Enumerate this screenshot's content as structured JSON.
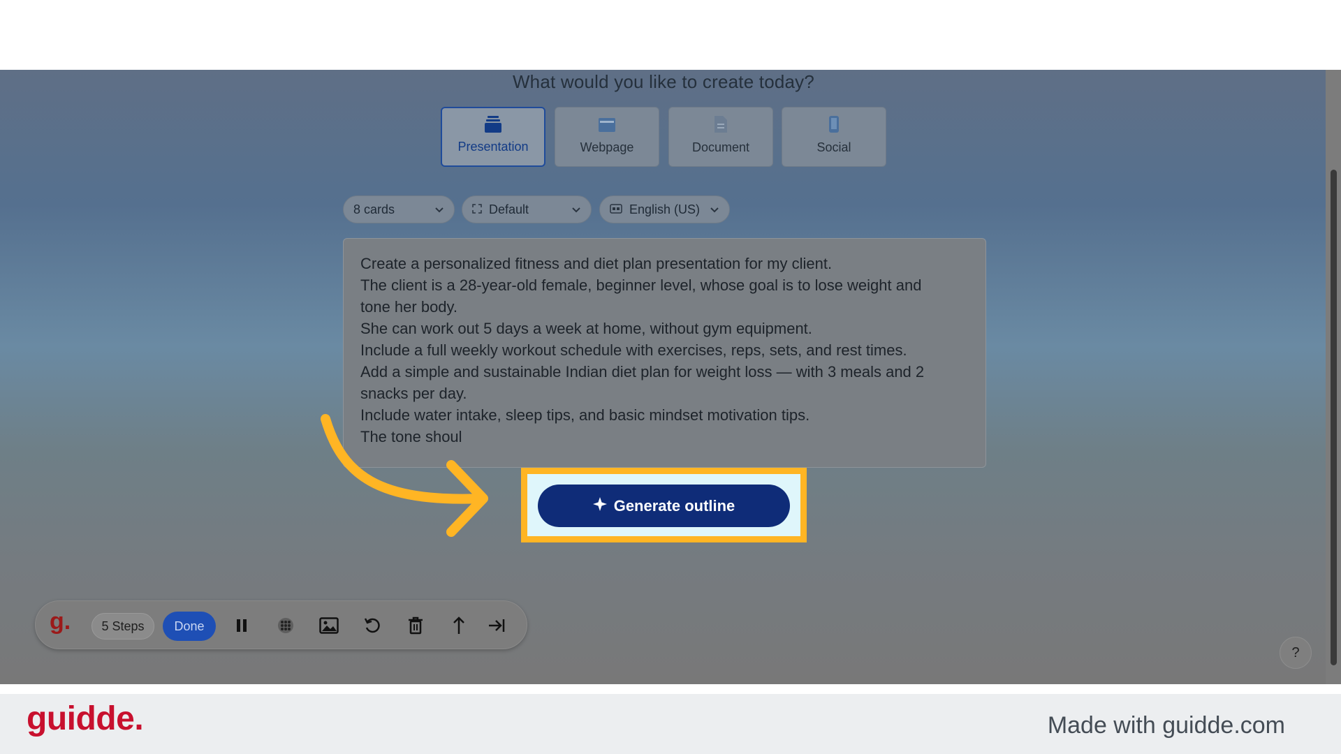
{
  "headline": "What would you like to create today?",
  "content_types": [
    {
      "label": "Presentation",
      "icon": "presentation-icon",
      "selected": true
    },
    {
      "label": "Webpage",
      "icon": "webpage-icon",
      "selected": false
    },
    {
      "label": "Document",
      "icon": "document-icon",
      "selected": false
    },
    {
      "label": "Social",
      "icon": "phone-icon",
      "selected": false
    }
  ],
  "options": {
    "cards": "8 cards",
    "format": "Default",
    "language": "English (US)"
  },
  "prompt_lines": [
    "Create a personalized fitness and diet plan presentation for my client.",
    "The client is a 28-year-old female, beginner level, whose goal is to lose weight and",
    "tone her body.",
    "She can work out 5 days a week at home, without gym equipment.",
    "Include a full weekly workout schedule with exercises, reps, sets, and rest times.",
    "Add a simple and sustainable Indian diet plan for weight loss — with 3 meals and 2",
    "snacks per day.",
    "Include water intake, sleep tips, and basic mindset motivation tips.",
    "The tone shoul"
  ],
  "generate_button": "Generate outline",
  "recorder": {
    "logo": "g.",
    "steps": "5 Steps",
    "done": "Done",
    "icons": [
      "pause-icon",
      "blur-icon",
      "image-icon",
      "undo-icon",
      "trash-icon",
      "cursor-up-icon",
      "skip-icon"
    ]
  },
  "help": "?",
  "footer": {
    "brand": "guidde.",
    "note": "Made with guidde.com"
  },
  "colors": {
    "highlight": "#ffb524",
    "button": "#0f2c78",
    "brand_red": "#c8102e"
  }
}
